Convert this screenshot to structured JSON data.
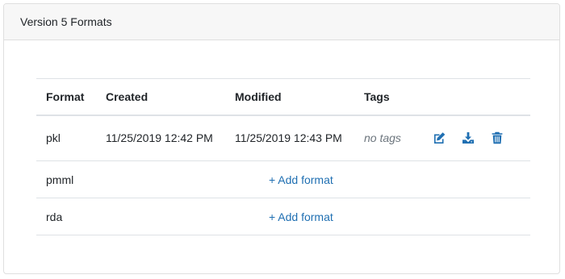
{
  "card": {
    "title": "Version 5 Formats"
  },
  "table": {
    "columns": [
      "Format",
      "Created",
      "Modified",
      "Tags"
    ],
    "rows": [
      {
        "format": "pkl",
        "created": "11/25/2019 12:42 PM",
        "modified": "11/25/2019 12:43 PM",
        "tags": "no tags",
        "actions": [
          "edit-icon",
          "download-icon",
          "trash-icon"
        ]
      },
      {
        "format": "pmml",
        "add_label": "+ Add format"
      },
      {
        "format": "rda",
        "add_label": "+ Add format"
      }
    ]
  },
  "colors": {
    "accent": "#1f6fb2",
    "header_bg": "#f7f7f7",
    "border": "#dee2e6",
    "muted": "#6c757d"
  }
}
